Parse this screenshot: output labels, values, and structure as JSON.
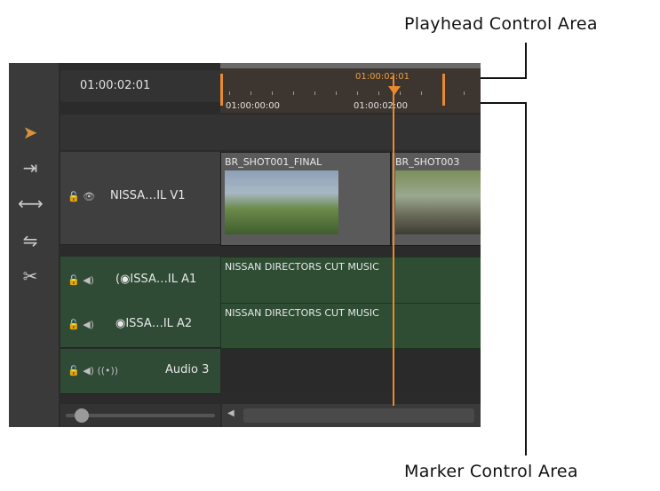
{
  "callouts": {
    "playhead_label": "Playhead Control Area",
    "marker_label": "Marker Control Area"
  },
  "timeline": {
    "current_timecode": "01:00:02:01",
    "ruler_playhead_tc": "01:00:02:01",
    "ruler_start_tc": "01:00:00:00",
    "ruler_mid_tc": "01:00:02:00"
  },
  "tools": [
    "select-arrow-icon",
    "insert-icon",
    "trim-icon",
    "slip-icon",
    "razor-icon"
  ],
  "tracks": {
    "v1": {
      "label": "NISSA…IL V1",
      "icons": "🔓 👁"
    },
    "a1": {
      "label": "(◉ISSA…IL A1",
      "icons": "🔓 ◀)"
    },
    "a2": {
      "label": "◉ISSA…IL A2",
      "icons": "🔓 ◀)"
    },
    "a3": {
      "label": "Audio 3",
      "icons": "🔓 ◀)  ((•))"
    }
  },
  "clips": {
    "video1": "BR_SHOT001_FINAL",
    "video2": "BR_SHOT003",
    "music1": "NISSAN DIRECTORS CUT MUSIC",
    "music2": "NISSAN DIRECTORS CUT MUSIC"
  },
  "colors": {
    "accent": "#e88a2e",
    "audio_track": "#2e4d33"
  }
}
